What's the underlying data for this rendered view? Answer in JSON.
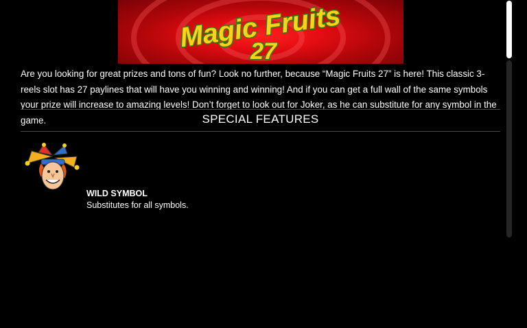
{
  "banner": {
    "logo_text_line1": "Magic Fruits",
    "logo_text_line2": "27"
  },
  "intro": {
    "text": "Are you looking for great prizes and tons of fun? Look no further, because “Magic Fruits 27” is here! This classic 3-reels slot has 27 paylines that will have you winning and winning! And if you can get a full wall of the same symbols your prize will increase to amazing levels! Don’t forget to look out for Joker, as he can substitute for any symbol in the game."
  },
  "special_features": {
    "title": "SPECIAL FEATURES",
    "items": [
      {
        "icon": "joker-icon",
        "name": "WILD SYMBOL",
        "description": "Substitutes for all symbols."
      }
    ]
  },
  "colors": {
    "background": "#000000",
    "banner_red": "#e30d12",
    "logo_yellow": "#ffd21a",
    "logo_green": "#7bd12b",
    "divider": "#4a4a4a",
    "scrollbar_thumb": "#ffffff"
  }
}
